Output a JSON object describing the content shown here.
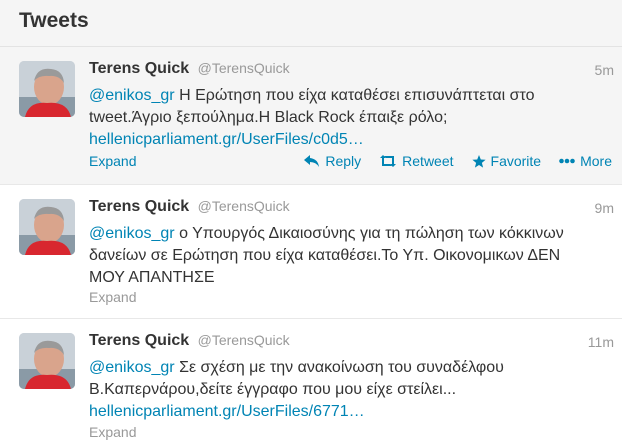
{
  "header": {
    "title": "Tweets"
  },
  "actions": {
    "reply": "Reply",
    "retweet": "Retweet",
    "favorite": "Favorite",
    "more": "More"
  },
  "tweets": [
    {
      "fullname": "Terens Quick",
      "username": "@TerensQuick",
      "time": "5m",
      "mention": "@enikos_gr",
      "text": " Η Ερώτηση που είχα καταθέσει επισυνάπτεται στο tweet.Άγριο ξεπούλημα.Η Black Rock έπαιξε ρόλο;",
      "link": "hellenicparliament.gr/UserFiles/c0d5…",
      "expand": "Expand"
    },
    {
      "fullname": "Terens Quick",
      "username": "@TerensQuick",
      "time": "9m",
      "mention": "@enikos_gr",
      "text": "  ο Υπουργός Δικαιοσύνης για τη πώληση των κόκκινων δανείων σε Ερώτηση που είχα καταθέσει.Το Υπ. Οικονομικων ΔΕΝ ΜΟΥ ΑΠΑΝΤΗΣΕ",
      "expand": "Expand"
    },
    {
      "fullname": "Terens Quick",
      "username": "@TerensQuick",
      "time": "11m",
      "mention": "@enikos_gr",
      "text": " Σε σχέση με την ανακοίνωση του συναδέλφου Β.Καπερνάρου,δείτε έγγραφο που μου είχε στείλει...",
      "link": "hellenicparliament.gr/UserFiles/6771…",
      "expand": "Expand"
    }
  ]
}
